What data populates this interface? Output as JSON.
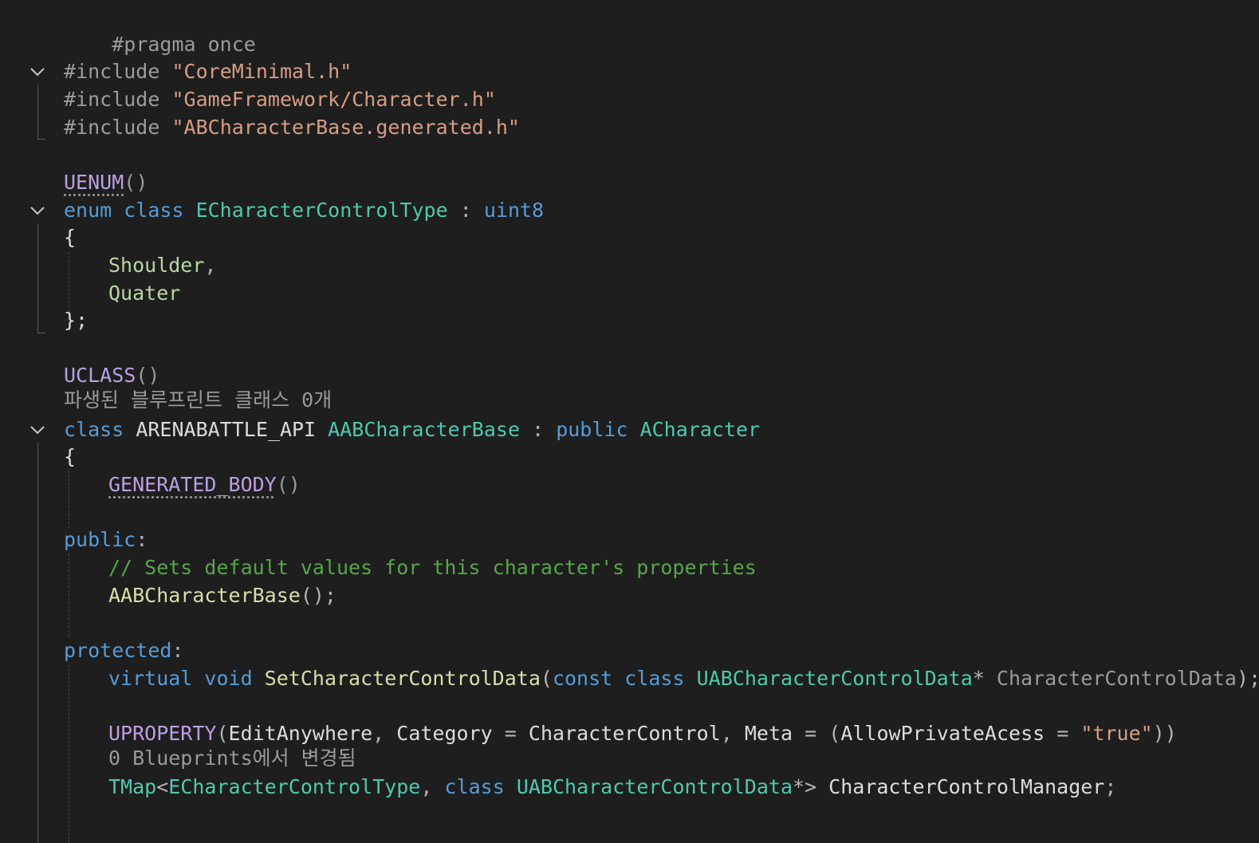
{
  "editor": {
    "lines": {
      "pragma": "#pragma once",
      "inc1_kw": "#include",
      "inc1_str": "\"CoreMinimal.h\"",
      "inc2_kw": "#include",
      "inc2_str": "\"GameFramework/Character.h\"",
      "inc3_kw": "#include",
      "inc3_str": "\"ABCharacterBase.generated.h\"",
      "uenum": "UENUM",
      "uenum_paren": "()",
      "enum_kw": "enum class",
      "enum_name": "ECharacterControlType",
      "enum_colon": ":",
      "enum_base": "uint8",
      "brace_open1": "{",
      "enum_v1": "Shoulder",
      "enum_v1_comma": ",",
      "enum_v2": "Quater",
      "brace_close1": "};",
      "uclass": "UCLASS",
      "uclass_paren": "()",
      "class_kw": "class",
      "class_api": "ARENABATTLE_API",
      "class_name": "AABCharacterBase",
      "class_colon": ":",
      "class_public": "public",
      "class_base": "ACharacter",
      "brace_open2": "{",
      "generated_body": "GENERATED_BODY",
      "generated_paren": "()",
      "public_label": "public",
      "public_colon": ":",
      "comment": "// Sets default values for this character's properties",
      "ctor": "AABCharacterBase",
      "ctor_rest": "();",
      "protected_label": "protected",
      "protected_colon": ":",
      "virt": "virtual",
      "void": "void",
      "fn_name": "SetCharacterControlData",
      "fn_paren": "(",
      "const_kw": "const",
      "class_kw2": "class",
      "param_type": "UABCharacterControlData",
      "param_ptr": "*",
      "param_name": "CharacterControlData",
      "fn_end": ");",
      "uprop": "UPROPERTY",
      "uprop_open": "(",
      "uprop_edit": "EditAnywhere",
      "uprop_comma1": ",",
      "uprop_cat": "Category",
      "uprop_eq1": "=",
      "uprop_catval": "CharacterControl",
      "uprop_comma2": ",",
      "uprop_meta": "Meta",
      "uprop_eq2": "=",
      "uprop_paren2": "(",
      "uprop_allow": "AllowPrivateAcess",
      "uprop_eq3": "=",
      "uprop_true": "\"true\"",
      "uprop_close": "))",
      "tmap": "TMap",
      "tmap_lt": "<",
      "tmap_t1": "ECharacterControlType",
      "tmap_comma": ",",
      "tmap_class": "class",
      "tmap_t2": "UABCharacterControlData",
      "tmap_gt": "*>",
      "tmap_var": "CharacterControlManager",
      "tmap_semi": ";"
    },
    "codelens": {
      "derived_blueprints": "파생된 블루프린트 클래스 0개",
      "blueprint_changes": "0 Blueprints에서 변경됨"
    },
    "colors": {
      "background": "#1e1e1e",
      "keyword": "#569cd6",
      "type": "#4ec9b0",
      "string": "#d69d85",
      "macro": "#bd9fe3",
      "comment": "#57a64a",
      "function": "#dcdcaa",
      "enum_value": "#b8d7a3"
    }
  }
}
